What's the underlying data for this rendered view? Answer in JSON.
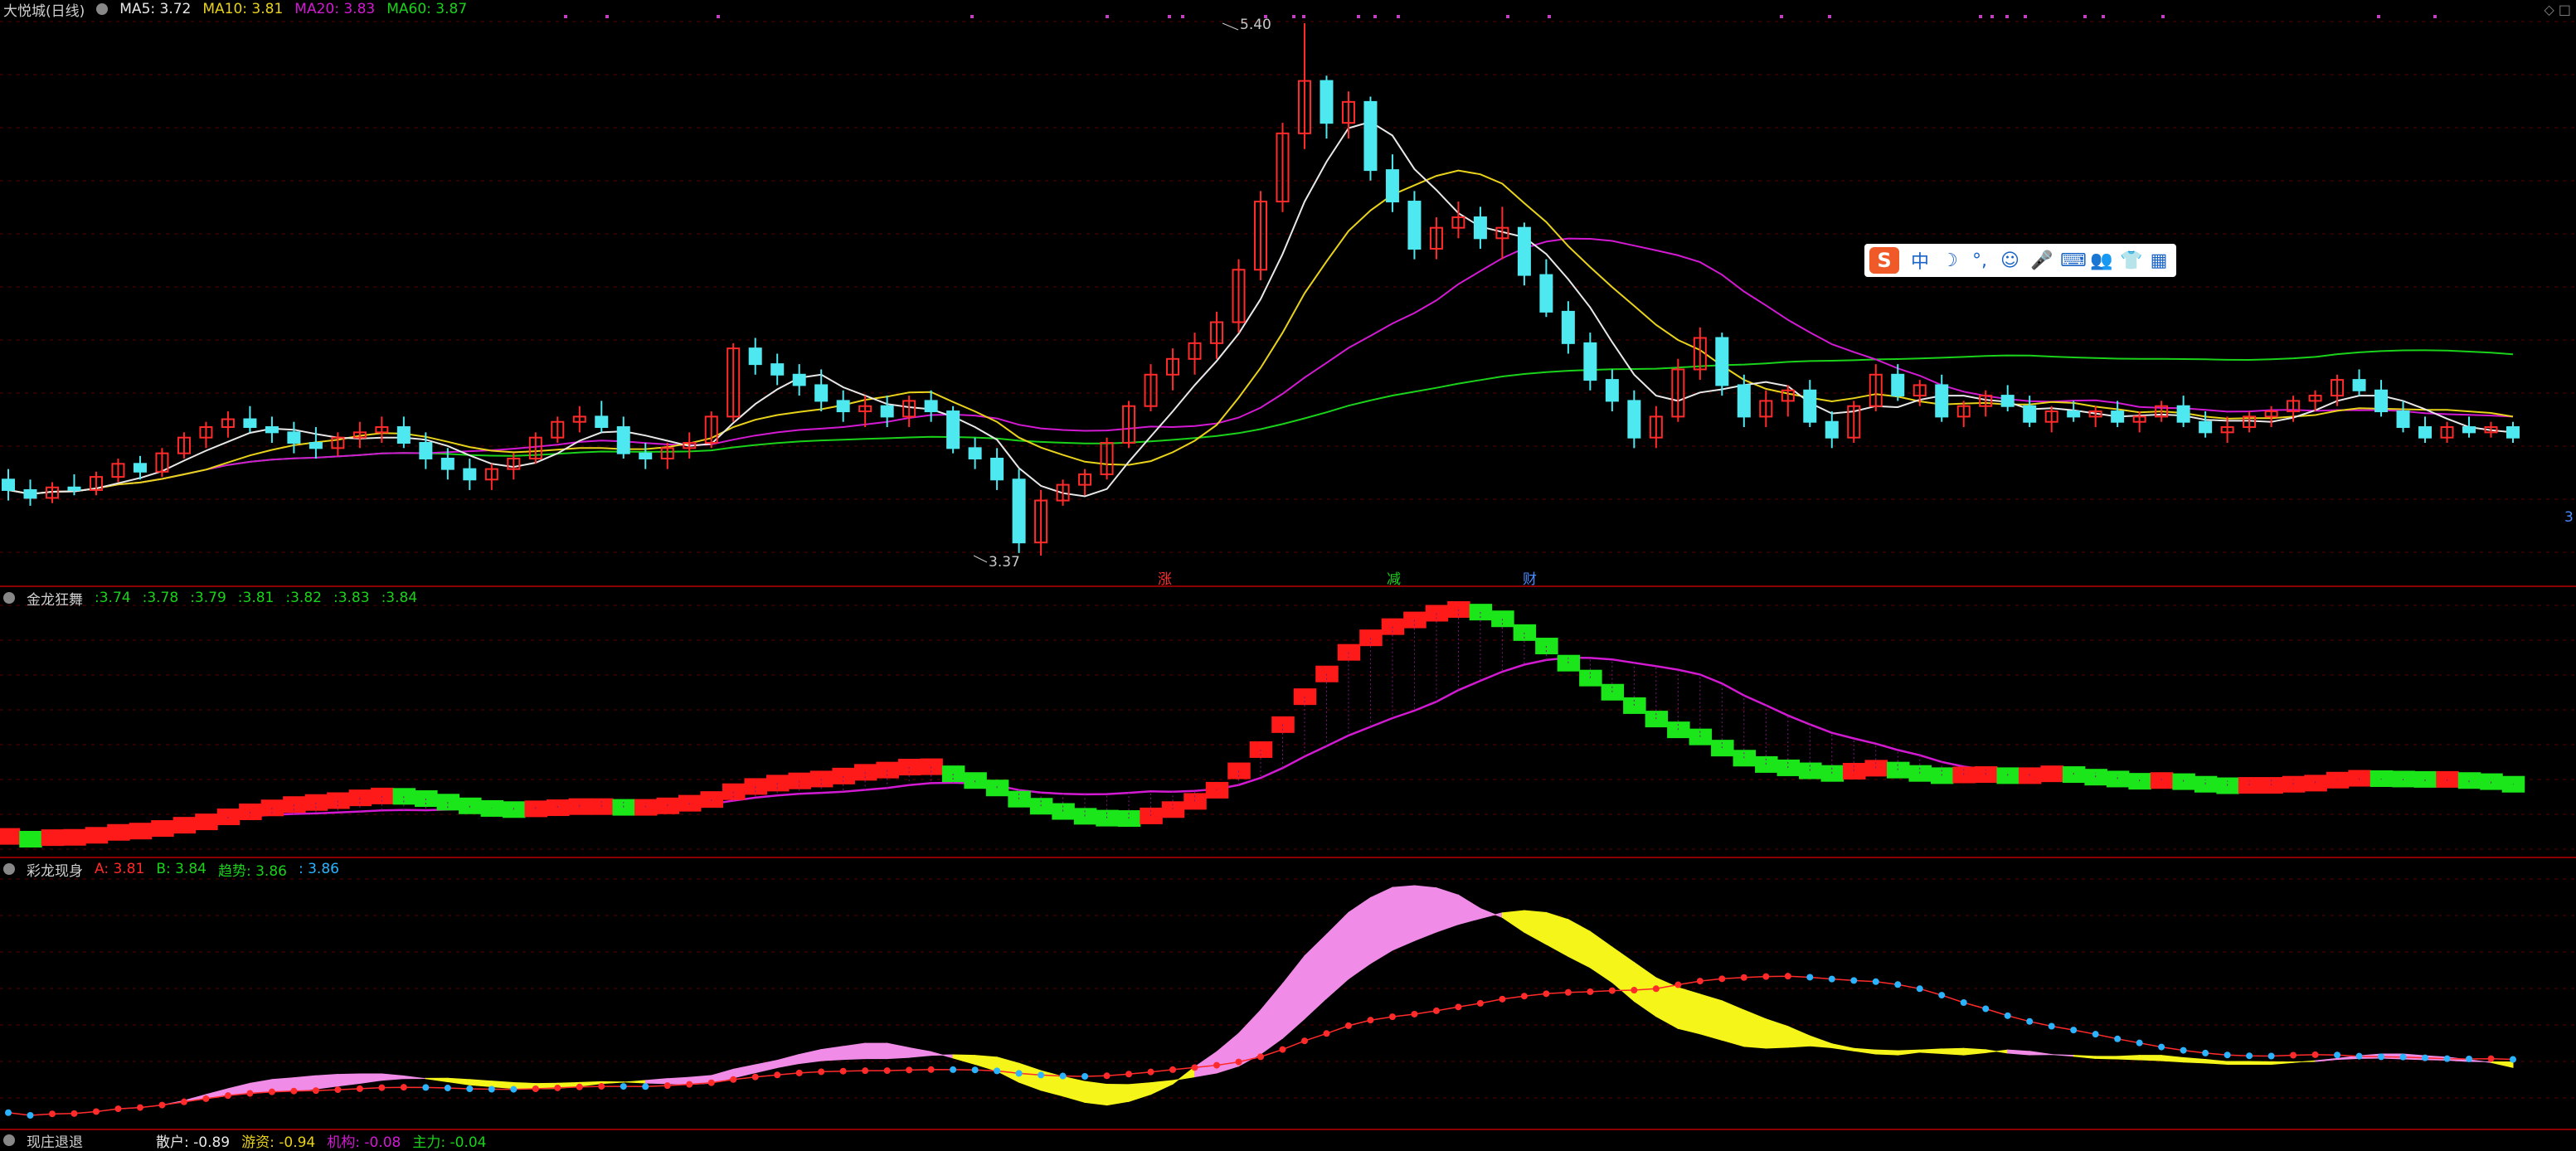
{
  "panels": {
    "main": {
      "title": "大悦城(日线)",
      "ma": [
        {
          "label": "MA5: 3.72",
          "color": "#e8e8e8"
        },
        {
          "label": "MA10: 3.81",
          "color": "#e8d21a"
        },
        {
          "label": "MA20: 3.83",
          "color": "#d21ad2"
        },
        {
          "label": "MA60: 3.87",
          "color": "#1ad21a"
        }
      ],
      "high_label": "5.40",
      "low_label": "3.37",
      "right_edge": "3"
    },
    "ind1": {
      "title": "金龙狂舞",
      "values": [
        ":3.74",
        ":3.78",
        ":3.79",
        ":3.81",
        ":3.82",
        ":3.83",
        ":3.84"
      ],
      "value_color": "#1ad21a"
    },
    "ind2": {
      "title": "彩龙现身",
      "values": [
        {
          "label": "A: 3.81",
          "color": "#ff2a2a"
        },
        {
          "label": "B: 3.84",
          "color": "#1ad21a"
        },
        {
          "label": "趋势: 3.86",
          "color": "#1ad21a"
        },
        {
          "label": ": 3.86",
          "color": "#2ab4ff"
        }
      ]
    },
    "ind3": {
      "title": "现庄退退",
      "values": [
        {
          "label": "散户: -0.89",
          "color": "#e8e8e8"
        },
        {
          "label": "游资: -0.94",
          "color": "#e8d21a"
        },
        {
          "label": "机构: -0.08",
          "color": "#d21ad2"
        },
        {
          "label": "主力: -0.04",
          "color": "#1ad21a"
        }
      ]
    }
  },
  "markers": [
    {
      "text": "涨",
      "color": "#ff3030"
    },
    {
      "text": "减",
      "color": "#1ad21a"
    },
    {
      "text": "财",
      "color": "#4a8cff"
    }
  ],
  "ime_toolbar": {
    "logo": "S",
    "buttons": [
      "中",
      "☽",
      "°,",
      "☺",
      "🎤",
      "⌨",
      "👥",
      "👕",
      "▦"
    ]
  },
  "corner": "◇ □",
  "colors": {
    "up": "#ff2a2a",
    "down": "#4ee8f0",
    "grid": "#5a0000",
    "sep": "#8b0000"
  },
  "chart_data": {
    "type": "candlestick",
    "title": "大悦城(日线)",
    "ylim": [
      3.37,
      5.4
    ],
    "ohlc": [
      [
        3.66,
        3.7,
        3.58,
        3.62
      ],
      [
        3.62,
        3.66,
        3.56,
        3.59
      ],
      [
        3.59,
        3.65,
        3.57,
        3.63
      ],
      [
        3.63,
        3.68,
        3.6,
        3.62
      ],
      [
        3.62,
        3.69,
        3.6,
        3.67
      ],
      [
        3.67,
        3.74,
        3.65,
        3.72
      ],
      [
        3.72,
        3.75,
        3.66,
        3.69
      ],
      [
        3.69,
        3.78,
        3.67,
        3.76
      ],
      [
        3.76,
        3.84,
        3.74,
        3.82
      ],
      [
        3.82,
        3.88,
        3.78,
        3.86
      ],
      [
        3.86,
        3.92,
        3.82,
        3.89
      ],
      [
        3.89,
        3.94,
        3.84,
        3.86
      ],
      [
        3.86,
        3.9,
        3.8,
        3.84
      ],
      [
        3.84,
        3.88,
        3.76,
        3.8
      ],
      [
        3.8,
        3.86,
        3.74,
        3.78
      ],
      [
        3.78,
        3.84,
        3.75,
        3.82
      ],
      [
        3.82,
        3.88,
        3.78,
        3.84
      ],
      [
        3.84,
        3.9,
        3.8,
        3.86
      ],
      [
        3.86,
        3.9,
        3.78,
        3.8
      ],
      [
        3.8,
        3.84,
        3.7,
        3.74
      ],
      [
        3.74,
        3.78,
        3.66,
        3.7
      ],
      [
        3.7,
        3.74,
        3.62,
        3.66
      ],
      [
        3.66,
        3.72,
        3.62,
        3.7
      ],
      [
        3.7,
        3.76,
        3.66,
        3.74
      ],
      [
        3.74,
        3.84,
        3.72,
        3.82
      ],
      [
        3.82,
        3.9,
        3.8,
        3.88
      ],
      [
        3.88,
        3.94,
        3.84,
        3.9
      ],
      [
        3.9,
        3.96,
        3.84,
        3.86
      ],
      [
        3.86,
        3.9,
        3.74,
        3.76
      ],
      [
        3.76,
        3.8,
        3.7,
        3.74
      ],
      [
        3.74,
        3.8,
        3.7,
        3.78
      ],
      [
        3.78,
        3.84,
        3.74,
        3.8
      ],
      [
        3.8,
        3.92,
        3.78,
        3.9
      ],
      [
        3.9,
        4.18,
        3.88,
        4.16
      ],
      [
        4.16,
        4.2,
        4.06,
        4.1
      ],
      [
        4.1,
        4.14,
        4.02,
        4.06
      ],
      [
        4.06,
        4.1,
        3.98,
        4.02
      ],
      [
        4.02,
        4.08,
        3.92,
        3.96
      ],
      [
        3.96,
        4.0,
        3.88,
        3.92
      ],
      [
        3.92,
        3.98,
        3.86,
        3.94
      ],
      [
        3.94,
        3.98,
        3.86,
        3.9
      ],
      [
        3.9,
        3.98,
        3.86,
        3.96
      ],
      [
        3.96,
        4.0,
        3.88,
        3.92
      ],
      [
        3.92,
        3.94,
        3.76,
        3.78
      ],
      [
        3.78,
        3.82,
        3.7,
        3.74
      ],
      [
        3.74,
        3.78,
        3.62,
        3.66
      ],
      [
        3.66,
        3.7,
        3.38,
        3.42
      ],
      [
        3.42,
        3.62,
        3.37,
        3.58
      ],
      [
        3.58,
        3.66,
        3.56,
        3.64
      ],
      [
        3.64,
        3.7,
        3.6,
        3.68
      ],
      [
        3.68,
        3.82,
        3.66,
        3.8
      ],
      [
        3.8,
        3.96,
        3.78,
        3.94
      ],
      [
        3.94,
        4.1,
        3.92,
        4.06
      ],
      [
        4.06,
        4.16,
        4.0,
        4.12
      ],
      [
        4.12,
        4.22,
        4.06,
        4.18
      ],
      [
        4.18,
        4.3,
        4.12,
        4.26
      ],
      [
        4.26,
        4.5,
        4.22,
        4.46
      ],
      [
        4.46,
        4.76,
        4.42,
        4.72
      ],
      [
        4.72,
        5.02,
        4.68,
        4.98
      ],
      [
        4.98,
        5.4,
        4.92,
        5.18
      ],
      [
        5.18,
        5.2,
        4.96,
        5.02
      ],
      [
        5.02,
        5.14,
        4.96,
        5.1
      ],
      [
        5.1,
        5.12,
        4.8,
        4.84
      ],
      [
        4.84,
        4.9,
        4.68,
        4.72
      ],
      [
        4.72,
        4.76,
        4.5,
        4.54
      ],
      [
        4.54,
        4.66,
        4.5,
        4.62
      ],
      [
        4.62,
        4.72,
        4.58,
        4.66
      ],
      [
        4.66,
        4.7,
        4.54,
        4.58
      ],
      [
        4.58,
        4.7,
        4.5,
        4.62
      ],
      [
        4.62,
        4.64,
        4.4,
        4.44
      ],
      [
        4.44,
        4.5,
        4.28,
        4.3
      ],
      [
        4.3,
        4.34,
        4.14,
        4.18
      ],
      [
        4.18,
        4.22,
        4.0,
        4.04
      ],
      [
        4.04,
        4.08,
        3.92,
        3.96
      ],
      [
        3.96,
        4.0,
        3.78,
        3.82
      ],
      [
        3.82,
        3.94,
        3.78,
        3.9
      ],
      [
        3.9,
        4.12,
        3.88,
        4.08
      ],
      [
        4.08,
        4.24,
        4.04,
        4.2
      ],
      [
        4.2,
        4.22,
        3.98,
        4.02
      ],
      [
        4.02,
        4.06,
        3.86,
        3.9
      ],
      [
        3.9,
        4.0,
        3.86,
        3.96
      ],
      [
        3.96,
        4.02,
        3.9,
        4.0
      ],
      [
        4.0,
        4.04,
        3.86,
        3.88
      ],
      [
        3.88,
        3.92,
        3.78,
        3.82
      ],
      [
        3.82,
        3.96,
        3.8,
        3.94
      ],
      [
        3.94,
        4.1,
        3.92,
        4.06
      ],
      [
        4.06,
        4.1,
        3.96,
        3.98
      ],
      [
        3.98,
        4.04,
        3.94,
        4.02
      ],
      [
        4.02,
        4.06,
        3.88,
        3.9
      ],
      [
        3.9,
        3.96,
        3.86,
        3.94
      ],
      [
        3.94,
        4.0,
        3.9,
        3.98
      ],
      [
        3.98,
        4.02,
        3.92,
        3.94
      ],
      [
        3.94,
        3.98,
        3.86,
        3.88
      ],
      [
        3.88,
        3.94,
        3.84,
        3.92
      ],
      [
        3.92,
        3.96,
        3.88,
        3.9
      ],
      [
        3.9,
        3.94,
        3.86,
        3.92
      ],
      [
        3.92,
        3.96,
        3.86,
        3.88
      ],
      [
        3.88,
        3.92,
        3.84,
        3.9
      ],
      [
        3.9,
        3.96,
        3.88,
        3.94
      ],
      [
        3.94,
        3.98,
        3.86,
        3.88
      ],
      [
        3.88,
        3.92,
        3.82,
        3.84
      ],
      [
        3.84,
        3.9,
        3.8,
        3.86
      ],
      [
        3.86,
        3.92,
        3.84,
        3.9
      ],
      [
        3.9,
        3.94,
        3.86,
        3.92
      ],
      [
        3.92,
        3.98,
        3.88,
        3.96
      ],
      [
        3.96,
        4.0,
        3.92,
        3.98
      ],
      [
        3.98,
        4.06,
        3.94,
        4.04
      ],
      [
        4.04,
        4.08,
        3.98,
        4.0
      ],
      [
        4.0,
        4.04,
        3.9,
        3.92
      ],
      [
        3.92,
        3.96,
        3.84,
        3.86
      ],
      [
        3.86,
        3.9,
        3.8,
        3.82
      ],
      [
        3.82,
        3.88,
        3.8,
        3.86
      ],
      [
        3.86,
        3.9,
        3.82,
        3.84
      ],
      [
        3.84,
        3.88,
        3.82,
        3.86
      ],
      [
        3.86,
        3.88,
        3.8,
        3.82
      ]
    ],
    "ma_values": [
      {
        "name": "MA5",
        "value": 3.72,
        "color": "#e8e8e8"
      },
      {
        "name": "MA10",
        "value": 3.81,
        "color": "#e8d21a"
      },
      {
        "name": "MA20",
        "value": 3.83,
        "color": "#d21ad2"
      },
      {
        "name": "MA60",
        "value": 3.87,
        "color": "#1ad21a"
      }
    ]
  }
}
